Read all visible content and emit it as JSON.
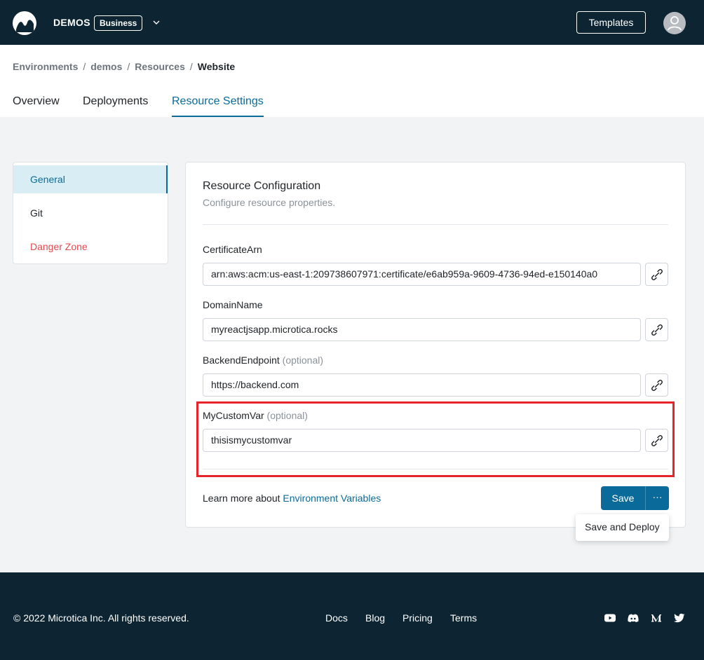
{
  "header": {
    "org_name": "DEMOS",
    "plan_badge": "Business",
    "templates_label": "Templates"
  },
  "breadcrumb": {
    "items": [
      "Environments",
      "demos",
      "Resources",
      "Website"
    ],
    "separator": "/"
  },
  "tabs": [
    {
      "label": "Overview",
      "active": false
    },
    {
      "label": "Deployments",
      "active": false
    },
    {
      "label": "Resource Settings",
      "active": true
    }
  ],
  "side_menu": [
    {
      "label": "General",
      "active": true
    },
    {
      "label": "Git",
      "active": false
    },
    {
      "label": "Danger Zone",
      "active": false,
      "danger": true
    }
  ],
  "card": {
    "title": "Resource Configuration",
    "subtitle": "Configure resource properties.",
    "fields": [
      {
        "label": "CertificateArn",
        "optional": "",
        "value": "arn:aws:acm:us-east-1:209738607971:certificate/e6ab959a-9609-4736-94ed-e150140a0"
      },
      {
        "label": "DomainName",
        "optional": "",
        "value": "myreactjsapp.microtica.rocks"
      },
      {
        "label": "BackendEndpoint",
        "optional": "(optional)",
        "value": "https://backend.com"
      },
      {
        "label": "MyCustomVar",
        "optional": "(optional)",
        "value": "thisismycustomvar"
      }
    ],
    "learn_more_prefix": "Learn more about",
    "learn_more_link": "Environment Variables",
    "save_label": "Save",
    "more_label": "···",
    "dropdown_item": "Save and Deploy"
  },
  "footer": {
    "copyright": "© 2022 Microtica Inc. All rights reserved.",
    "links": [
      "Docs",
      "Blog",
      "Pricing",
      "Terms"
    ],
    "social_icons": [
      "youtube-icon",
      "discord-icon",
      "medium-icon",
      "twitter-icon"
    ]
  },
  "colors": {
    "nav_bg": "#0d2533",
    "accent": "#0a6b9a",
    "danger": "#e5484d",
    "highlight": "#e8232a"
  }
}
